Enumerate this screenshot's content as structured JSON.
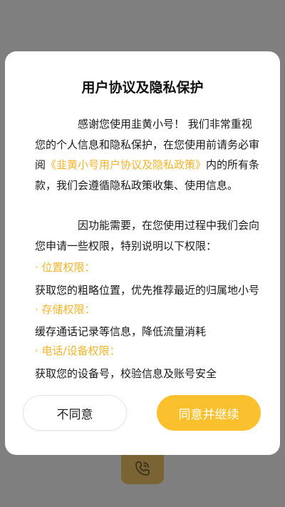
{
  "dialog": {
    "title": "用户协议及隐私保护",
    "para1_before": "感谢您使用韭黄小号！ 我们非常重视您的个人信息和隐私保护，在您使用前请务必审阅",
    "para1_link": "《韭黄小号用户协议及隐私政策》",
    "para1_after": "内的所有条款，我们会遵循隐私政策收集、使用信息。",
    "para2": "因功能需要，在您使用过程中我们会向您申请一些权限，特别说明以下权限：",
    "permissions": [
      {
        "title": "· 位置权限：",
        "desc": "获取您的粗略位置，优先推荐最近的归属地小号"
      },
      {
        "title": "· 存储权限：",
        "desc": "缓存通话记录等信息，降低流量消耗"
      },
      {
        "title": "· 电话/设备权限：",
        "desc": "获取您的设备号，校验信息及账号安全"
      }
    ],
    "disagree_label": "不同意",
    "agree_label": "同意并继续"
  },
  "colors": {
    "accent": "#fbc02d",
    "link": "#f2b42c",
    "overlay": "#7f7f7f"
  },
  "background": {
    "icon": "phone-icon"
  }
}
